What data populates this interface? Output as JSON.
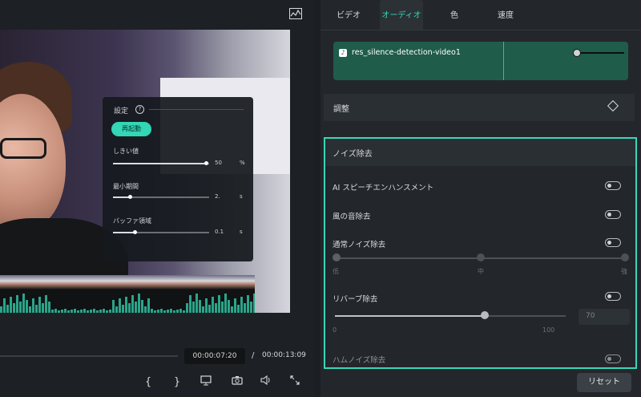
{
  "tabs": [
    {
      "label": "ビデオ"
    },
    {
      "label": "オーディオ"
    },
    {
      "label": "色"
    },
    {
      "label": "速度"
    }
  ],
  "audio_clip": {
    "name": "res_silence-detection-video1"
  },
  "adjust": {
    "label": "調整"
  },
  "noise": {
    "title": "ノイズ除去",
    "ai_speech": "AI スピーチエンハンスメント",
    "wind": "風の音除去",
    "normal": "通常ノイズ除去",
    "normal_ticks": [
      "低",
      "中",
      "強"
    ],
    "reverb": "リバーブ除去",
    "reverb_value": "70",
    "reverb_min": "0",
    "reverb_max": "100",
    "reverb_level": 0.65,
    "hum": "ハムノイズ除去"
  },
  "reset_label": "リセット",
  "overlay": {
    "title": "設定",
    "help_icon": "question-icon",
    "rerun": "再起動",
    "threshold_label": "しきい値",
    "threshold_value": "50",
    "threshold_unit": "%",
    "min_duration_label": "最小期間",
    "min_duration_value": "2.",
    "min_duration_unit": "s",
    "buffer_label": "バッファ領域",
    "buffer_value": "0.1",
    "buffer_unit": "s"
  },
  "player": {
    "current_time": "00:00:07:20",
    "separator": "/",
    "total_time": "00:00:13:09"
  },
  "colors": {
    "accent": "#38d6b8",
    "clip": "#1f5c4a",
    "panel": "#23272c"
  }
}
